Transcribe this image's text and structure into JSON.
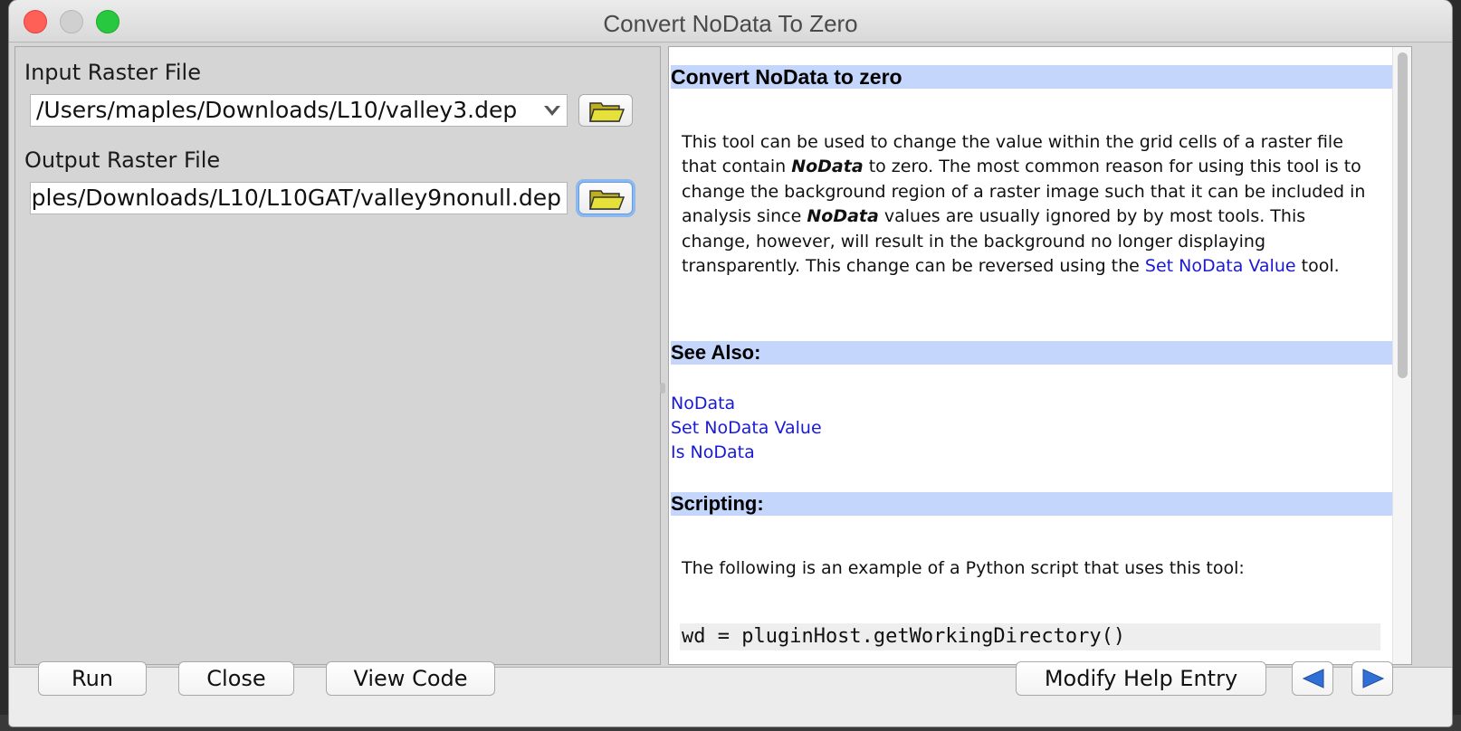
{
  "window": {
    "title": "Convert NoData To Zero"
  },
  "inputs": {
    "input_raster": {
      "label": "Input Raster File",
      "value": "/Users/maples/Downloads/L10/valley3.dep"
    },
    "output_raster": {
      "label": "Output Raster File",
      "value": "ples/Downloads/L10/L10GAT/valley9nonull.dep"
    }
  },
  "help": {
    "heading": "Convert NoData to zero",
    "para1": {
      "t1": "This tool can be used to change the value within the grid cells of a raster file that contain ",
      "b1": "NoData",
      "t2": " to zero. The most common reason for using this tool is to change the background region of a raster image such that it can be included in analysis since ",
      "b2": "NoData",
      "t3": " values are usually ignored by by most tools. This change, however, will result in the background no longer displaying transparently. This change can be reversed using the ",
      "link": "Set NoData Value",
      "t4": " tool."
    },
    "see_also_heading": "See Also:",
    "see_also_links": [
      "NoData",
      "Set NoData Value",
      "Is NoData"
    ],
    "scripting_heading": "Scripting:",
    "scripting_text": "The following is an example of a Python script that uses this tool:",
    "code_line": "wd = pluginHost.getWorkingDirectory()"
  },
  "buttons": {
    "run": "Run",
    "close": "Close",
    "view_code": "View Code",
    "modify_help": "Modify Help Entry"
  },
  "icons": {
    "folder": "folder-open-icon",
    "dropdown": "chevron-down-icon",
    "back": "arrow-left-icon",
    "forward": "arrow-right-icon"
  },
  "colors": {
    "section_bar": "#c4d6fb",
    "link": "#1a1ad6",
    "nav_arrow": "#2f6fd6"
  }
}
